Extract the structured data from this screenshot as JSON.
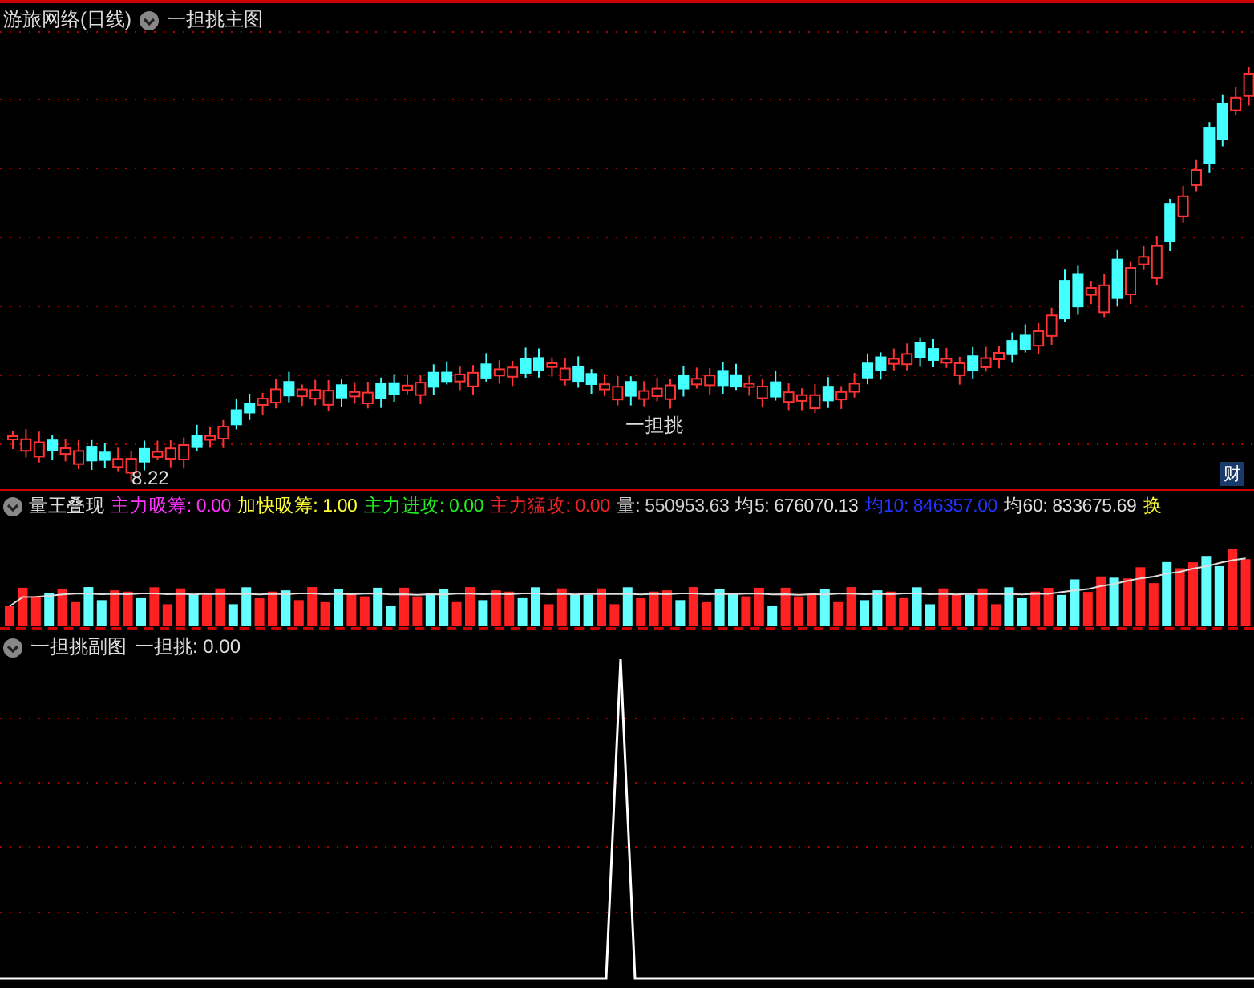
{
  "main_panel": {
    "title": "游旅网络(日线)",
    "indicator": "一担挑主图",
    "low_label": "8.22",
    "signal_label": "一担挑",
    "badge": "财"
  },
  "volume_panel": {
    "title": "量王叠现",
    "readings": [
      {
        "text": "主力吸筹: 0.00",
        "color": "#ff33ff"
      },
      {
        "text": "加快吸筹: 1.00",
        "color": "#ffff33"
      },
      {
        "text": "主力进攻: 0.00",
        "color": "#22ee22"
      },
      {
        "text": "主力猛攻: 0.00",
        "color": "#ee2222"
      },
      {
        "text": "量: 550953.63",
        "color": "#cccccc"
      },
      {
        "text": "均5: 676070.13",
        "color": "#dddddd"
      },
      {
        "text": "均10: 846357.00",
        "color": "#2233ff"
      },
      {
        "text": "均60: 833675.69",
        "color": "#dddddd"
      },
      {
        "text": "换",
        "color": "#ffff33"
      }
    ]
  },
  "sub_panel": {
    "title": "一担挑副图",
    "readings": [
      {
        "text": "一担挑: 0.00",
        "color": "#dddddd"
      }
    ]
  }
}
